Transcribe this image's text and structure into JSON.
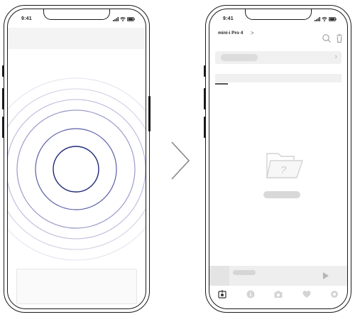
{
  "left_screen": {
    "status_time": "9:41",
    "status_icons": [
      "signal-icon",
      "wifi-icon",
      "battery-icon"
    ],
    "ripple_colors": {
      "core": "#1e2a78",
      "mid": "#5b5fa8",
      "outer": "#b8b8dc"
    }
  },
  "transition_arrow": {
    "icon": "chevron-right-icon",
    "color": "#888888"
  },
  "right_screen": {
    "status_time": "9:41",
    "status_icons": [
      "signal-icon",
      "wifi-icon",
      "battery-icon"
    ],
    "header": {
      "device_name": "mini-i Pro 4",
      "chevron": ">",
      "actions": [
        "search-icon",
        "trash-icon"
      ]
    },
    "row": {
      "chevron": "›"
    },
    "empty_state": {
      "icon": "folder-question-icon",
      "mark": "?"
    },
    "tabbar": {
      "items": [
        "recordings-icon",
        "info-icon",
        "camera-icon",
        "heart-icon",
        "settings-icon"
      ]
    }
  }
}
